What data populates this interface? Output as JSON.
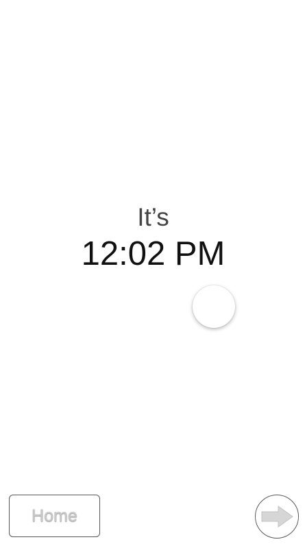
{
  "greeting": {
    "prefix": "It’s",
    "time": "12:02 PM"
  },
  "controls": {
    "toggle_icon": "circle-toggle",
    "home_label": "Home",
    "next_icon": "arrow-right-icon"
  },
  "colors": {
    "background": "#ffffff",
    "prefix_text": "#444444",
    "time_text": "#111111",
    "button_border": "#555555",
    "home_text": "#c8c8c8",
    "arrow_fill": "#d6d6d6"
  }
}
